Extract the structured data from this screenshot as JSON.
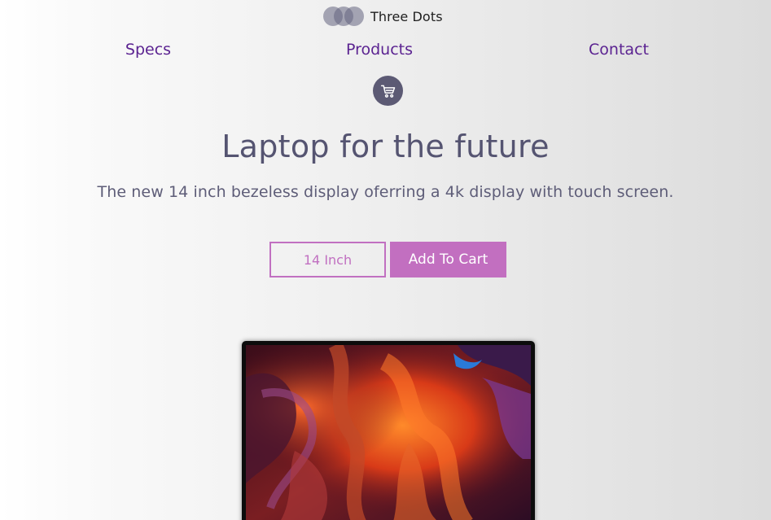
{
  "brand": {
    "name": "Three Dots",
    "icon": "three-dots-logo-icon"
  },
  "nav": {
    "items": [
      {
        "label": "Specs"
      },
      {
        "label": "Products"
      },
      {
        "label": "Contact"
      }
    ],
    "cart_icon": "shopping-cart-icon"
  },
  "hero": {
    "title": "Laptop for the future",
    "subtitle": "The new 14 inch bezeless display oferring a 4k display with touch screen.",
    "size_option": "14 Inch",
    "add_to_cart": "Add To Cart"
  },
  "colors": {
    "nav_link": "#5b2391",
    "accent": "#c26fc0",
    "heading": "#555471",
    "cart_circle": "#5c5a74"
  }
}
